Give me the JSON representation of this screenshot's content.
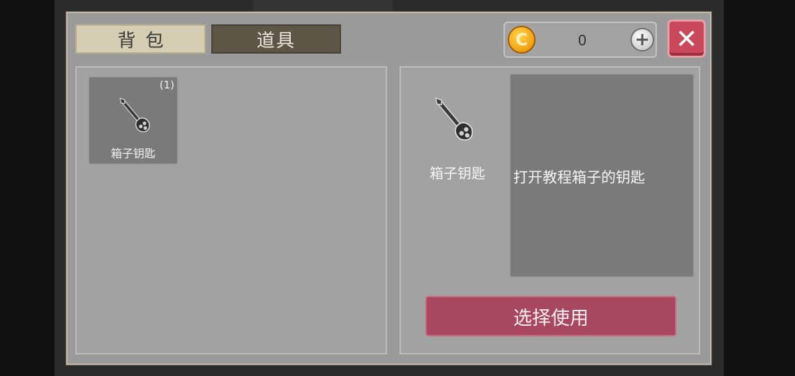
{
  "tabs": {
    "bag_label": "背包",
    "items_label": "道具"
  },
  "currency": {
    "coin_symbol": "C",
    "amount": "0",
    "add_symbol": "+"
  },
  "close_symbol": "✕",
  "inventory": [
    {
      "name": "箱子钥匙",
      "count": "(1)",
      "icon": "key-icon"
    }
  ],
  "detail": {
    "name": "箱子钥匙",
    "description": "打开教程箱子的钥匙",
    "icon": "key-icon"
  },
  "use_button_label": "选择使用",
  "colors": {
    "accent_button": "#a84860",
    "close_button": "#c9485a",
    "coin": "#f0a010",
    "tab_active": "#d6ceb2",
    "tab_inactive": "#5d5546"
  }
}
